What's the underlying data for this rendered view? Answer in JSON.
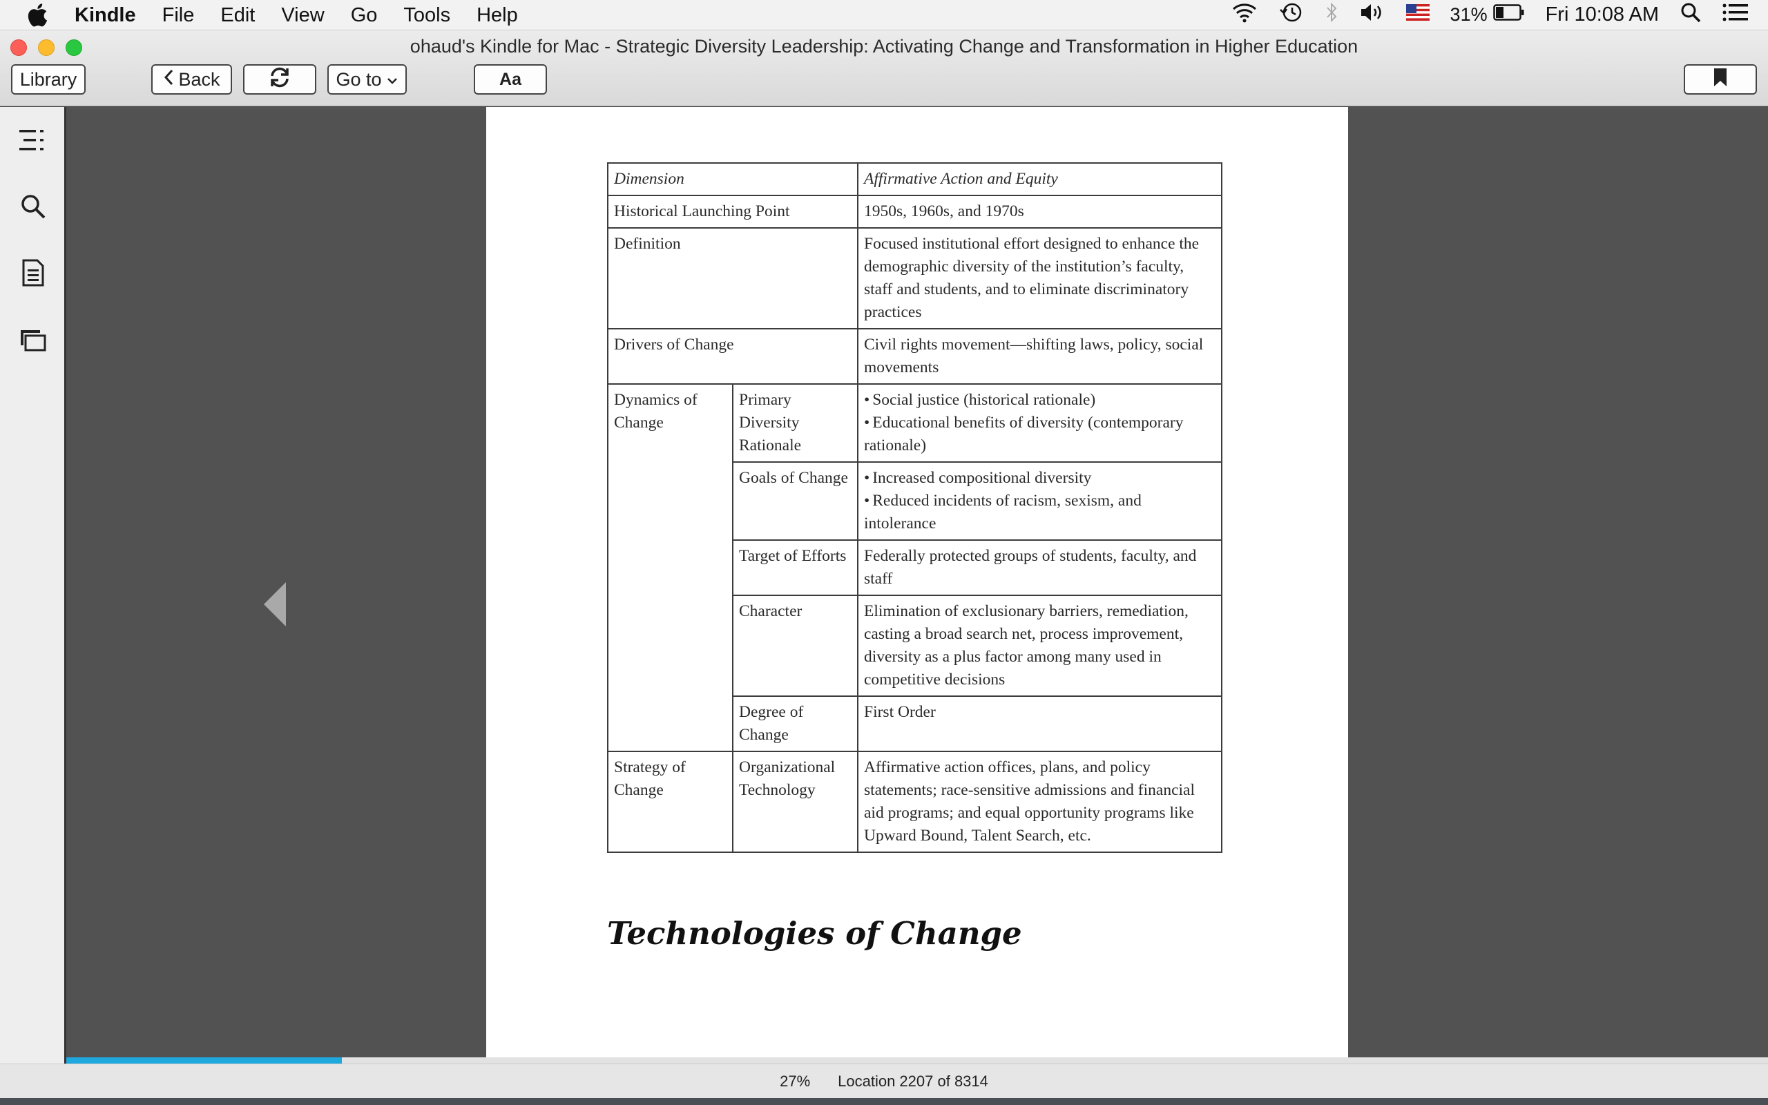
{
  "menubar": {
    "app_name": "Kindle",
    "items": [
      "File",
      "Edit",
      "View",
      "Go",
      "Tools",
      "Help"
    ],
    "battery_percent": "31%",
    "clock": "Fri 10:08 AM",
    "icons": [
      "apple-icon",
      "wifi-icon",
      "time-machine-icon",
      "bluetooth-icon",
      "volume-icon",
      "us-flag-icon",
      "battery-icon",
      "spotlight-icon",
      "notification-center-icon"
    ]
  },
  "window": {
    "title": "ohaud's Kindle for Mac - Strategic Diversity Leadership: Activating Change and Transformation in Higher Education"
  },
  "toolbar": {
    "library_label": "Library",
    "back_label": "Back",
    "goto_label": "Go to",
    "font_label": "Aa"
  },
  "sidebar": {
    "icons": [
      "table-of-contents-icon",
      "search-icon",
      "notes-icon",
      "flashcards-icon"
    ]
  },
  "book": {
    "table": {
      "header": [
        "Dimension",
        "Affirmative Action and Equity"
      ],
      "historical_label": "Historical Launching Point",
      "historical_value": "1950s, 1960s, and 1970s",
      "definition_label": "Definition",
      "definition_value": "Focused institutional effort designed to enhance the demographic diversity of the institution’s faculty, staff and students, and to eliminate discriminatory practices",
      "drivers_label": "Drivers of Change",
      "drivers_value": "Civil rights movement—shifting laws, policy, social movements",
      "dynamics_label": "Dynamics of Change",
      "rationale_label": "Primary Diversity Rationale",
      "rationale_items": [
        "Social justice (historical rationale)",
        "Educational benefits of diversity (contemporary rationale)"
      ],
      "goals_label": "Goals of Change",
      "goals_items": [
        "Increased compositional diversity",
        "Reduced incidents of racism, sexism, and intolerance"
      ],
      "target_label": "Target of Efforts",
      "target_value": "Federally protected groups of students, faculty, and staff",
      "character_label": "Character",
      "character_value": "Elimination of exclusionary barriers, remediation, casting a broad search net, process improvement, diversity as a plus factor among many used in competitive decisions",
      "degree_label": "Degree of Change",
      "degree_value": "First Order",
      "strategy_label": "Strategy of Change",
      "orgtech_label": "Organizational Technology",
      "orgtech_value": "Affirmative action offices, plans, and policy statements; race-sensitive admissions and financial aid programs; and equal opportunity programs like Upward Bound, Talent Search, etc."
    },
    "section_heading": "Technologies of Change"
  },
  "footer": {
    "percent": "27%",
    "location": "Location 2207 of 8314",
    "progress_fraction": 0.27
  },
  "colors": {
    "progress": "#1fa8de",
    "reader_background": "#525252"
  }
}
